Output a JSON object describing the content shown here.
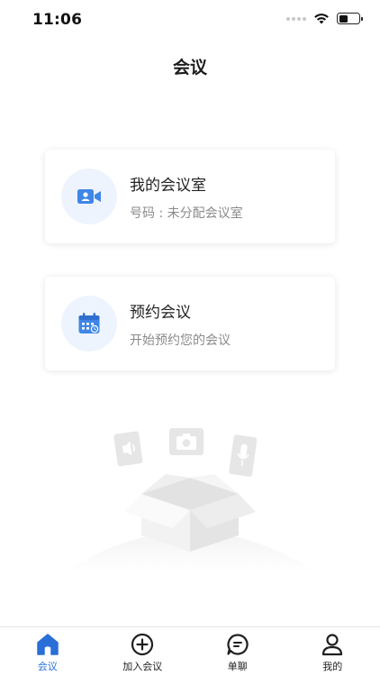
{
  "status_bar": {
    "time": "11:06"
  },
  "header": {
    "title": "会议"
  },
  "cards": [
    {
      "title": "我的会议室",
      "subtitle": "号码 : 未分配会议室",
      "icon": "video-camera-icon"
    },
    {
      "title": "预约会议",
      "subtitle": "开始预约您的会议",
      "icon": "calendar-icon"
    }
  ],
  "tab_bar": {
    "items": [
      {
        "label": "会议",
        "icon": "home-icon",
        "active": true
      },
      {
        "label": "加入会议",
        "icon": "plus-circle-icon",
        "active": false
      },
      {
        "label": "单聊",
        "icon": "chat-bubble-icon",
        "active": false
      },
      {
        "label": "我的",
        "icon": "person-icon",
        "active": false
      }
    ]
  },
  "colors": {
    "accent": "#2a6fd8",
    "icon_blue": "#3f86e6",
    "icon_bg": "#eef4fd",
    "subtitle": "#8a8a8a"
  }
}
